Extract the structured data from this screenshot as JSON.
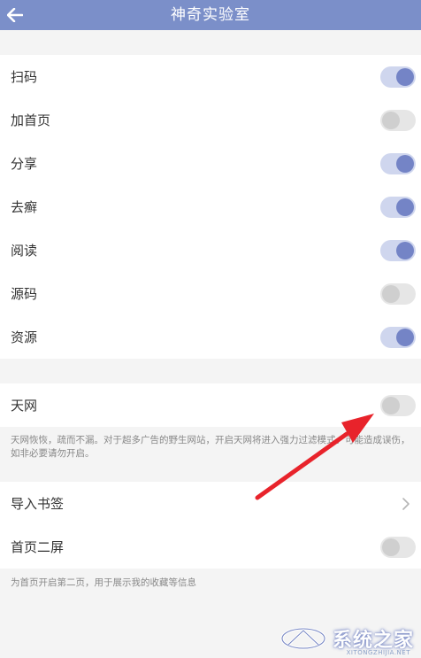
{
  "header": {
    "title": "神奇实验室",
    "back_icon": "back-arrow-icon"
  },
  "colors": {
    "header_bg": "#7b8fc9",
    "toggle_on_track": "#cfd6ee",
    "toggle_on_knob": "#7484c6",
    "toggle_off_track": "#e6e6e6",
    "toggle_off_knob": "#cfcfcf",
    "annotation_arrow": "#e8232b"
  },
  "group1": {
    "items": [
      {
        "label": "扫码",
        "on": true
      },
      {
        "label": "加首页",
        "on": false
      },
      {
        "label": "分享",
        "on": true
      },
      {
        "label": "去癣",
        "on": true
      },
      {
        "label": "阅读",
        "on": true
      },
      {
        "label": "源码",
        "on": false
      },
      {
        "label": "资源",
        "on": true
      }
    ]
  },
  "tianwang": {
    "label": "天网",
    "on": false,
    "description": "天网恢恢，疏而不漏。对于超多广告的野生网站，开启天网将进入强力过滤模式。可能造成误伤，如非必要请勿开启。"
  },
  "group3": {
    "import_bookmarks": "导入书签",
    "home_second_screen": {
      "label": "首页二屏",
      "on": false
    },
    "description": "为首页开启第二页，用于展示我的收藏等信息"
  },
  "watermark": {
    "text": "系统之家",
    "sub": "XITONGZHIJIA.NET"
  }
}
